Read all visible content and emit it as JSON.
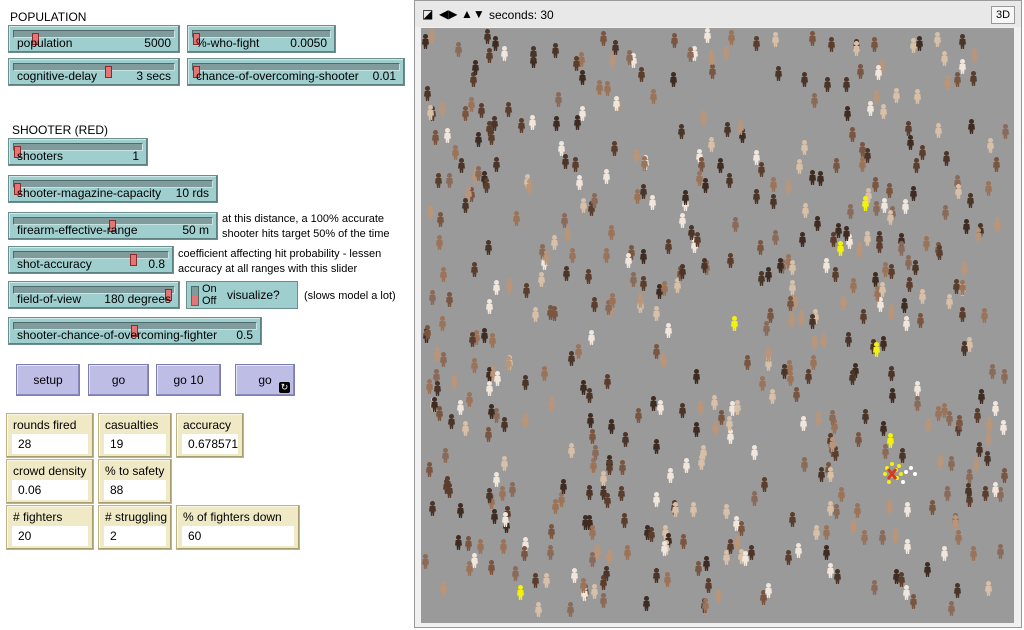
{
  "population_section": {
    "title": "POPULATION",
    "population": {
      "label": "population",
      "value": "5000",
      "fraction": 0.12
    },
    "pct_who_fight": {
      "label": "%-who-fight",
      "value": "0.0050",
      "fraction": 0.0
    },
    "cognitive_delay": {
      "label": "cognitive-delay",
      "value": "3 secs",
      "fraction": 0.6
    },
    "chance_overcoming_shooter": {
      "label": "chance-of-overcoming-shooter",
      "value": "0.01",
      "fraction": 0.0
    }
  },
  "shooter_section": {
    "title": "SHOOTER (RED)",
    "shooters": {
      "label": "shooters",
      "value": "1",
      "fraction": 0.0
    },
    "magazine": {
      "label": "shooter-magazine-capacity",
      "value": "10 rds",
      "fraction": 0.0
    },
    "range": {
      "label": "firearm-effective-range",
      "value": "50 m",
      "fraction": 0.5
    },
    "range_note": [
      "at this distance, a 100% accurate",
      "shooter hits target 50% of the time"
    ],
    "accuracy": {
      "label": "shot-accuracy",
      "value": "0.8",
      "fraction": 0.8
    },
    "accuracy_note": [
      "coefficient affecting hit probability - lessen",
      "accuracy at all ranges with this slider"
    ],
    "fov": {
      "label": "field-of-view",
      "value": "180 degrees",
      "fraction": 1.0
    },
    "visualize": {
      "on": "On",
      "off": "Off",
      "label": "visualize?"
    },
    "visualize_note": "(slows model a lot)",
    "fighter_chance": {
      "label": "shooter-chance-of-overcoming-fighter",
      "value": "0.5",
      "fraction": 0.5
    }
  },
  "buttons": {
    "setup": "setup",
    "go": "go",
    "go10": "go 10",
    "go_forever": "go"
  },
  "monitors": {
    "rounds_fired": {
      "label": "rounds fired",
      "value": "28"
    },
    "casualties": {
      "label": "casualties",
      "value": "19"
    },
    "accuracy": {
      "label": "accuracy",
      "value": "0.6785714"
    },
    "crowd_density": {
      "label": "crowd density",
      "value": "0.06"
    },
    "pct_safety": {
      "label": "% to safety",
      "value": "88"
    },
    "fighters": {
      "label": "# fighters",
      "value": "20"
    },
    "struggling": {
      "label": "# struggling",
      "value": "2"
    },
    "pct_fighters_down": {
      "label": "% of fighters down",
      "value": "60"
    }
  },
  "view": {
    "ticks_label": "seconds: 30",
    "btn_3d": "3D",
    "icons": [
      "view-shape-icon",
      "left-right-arrows-icon",
      "up-down-arrows-icon"
    ]
  },
  "colors": {
    "slider_bg": "#9fcecf",
    "button_bg": "#bdbde6",
    "monitor_bg": "#efe9c6",
    "world_bg": "#9a9a9a",
    "fighter": "#f2f20a",
    "shooter": "#d63b1e"
  }
}
